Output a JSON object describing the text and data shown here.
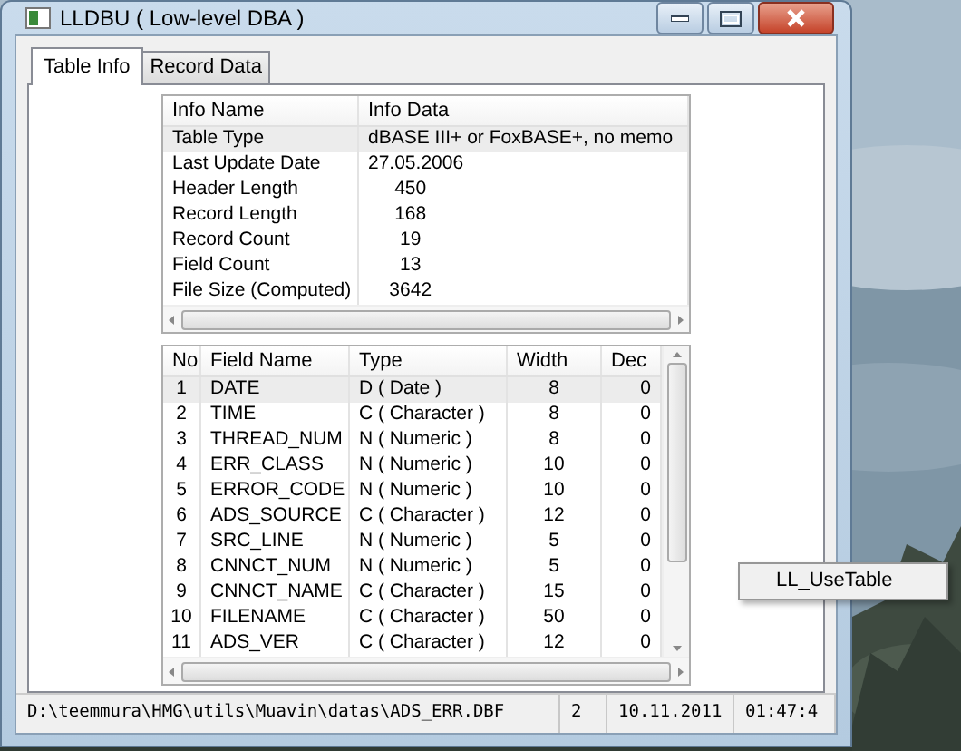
{
  "window": {
    "title": "LLDBU ( Low-level DBA )"
  },
  "tabs": [
    {
      "label": "Table Info",
      "selected": true
    },
    {
      "label": "Record Data",
      "selected": false
    }
  ],
  "info_table": {
    "columns": [
      "Info Name",
      "Info Data"
    ],
    "rows": [
      {
        "cells": [
          "Table Type",
          "dBASE III+ or FoxBASE+, no memo"
        ],
        "selected": true
      },
      {
        "cells": [
          "Last Update Date",
          "27.05.2006"
        ],
        "selected": false
      },
      {
        "cells": [
          "Header Length",
          "     450"
        ],
        "selected": false
      },
      {
        "cells": [
          "Record Length",
          "     168"
        ],
        "selected": false
      },
      {
        "cells": [
          "Record Count",
          "      19"
        ],
        "selected": false
      },
      {
        "cells": [
          "Field Count",
          "      13"
        ],
        "selected": false
      },
      {
        "cells": [
          "File Size (Computed)",
          "    3642"
        ],
        "selected": false
      }
    ]
  },
  "fields_table": {
    "columns": [
      "No",
      "Field Name",
      "Type",
      "Width",
      "Dec"
    ],
    "rows": [
      {
        "cells": [
          "1",
          "DATE",
          "D ( Date )",
          "8",
          "0"
        ],
        "selected": true
      },
      {
        "cells": [
          "2",
          "TIME",
          "C ( Character )",
          "8",
          "0"
        ],
        "selected": false
      },
      {
        "cells": [
          "3",
          "THREAD_NUM",
          "N ( Numeric )",
          "8",
          "0"
        ],
        "selected": false
      },
      {
        "cells": [
          "4",
          "ERR_CLASS",
          "N ( Numeric )",
          "10",
          "0"
        ],
        "selected": false
      },
      {
        "cells": [
          "5",
          "ERROR_CODE",
          "N ( Numeric )",
          "10",
          "0"
        ],
        "selected": false
      },
      {
        "cells": [
          "6",
          "ADS_SOURCE",
          "C ( Character )",
          "12",
          "0"
        ],
        "selected": false
      },
      {
        "cells": [
          "7",
          "SRC_LINE",
          "N ( Numeric )",
          "5",
          "0"
        ],
        "selected": false
      },
      {
        "cells": [
          "8",
          "CNNCT_NUM",
          "N ( Numeric )",
          "5",
          "0"
        ],
        "selected": false
      },
      {
        "cells": [
          "9",
          "CNNCT_NAME",
          "C ( Character )",
          "15",
          "0"
        ],
        "selected": false
      },
      {
        "cells": [
          "10",
          "FILENAME",
          "C ( Character )",
          "50",
          "0"
        ],
        "selected": false
      },
      {
        "cells": [
          "11",
          "ADS_VER",
          "C ( Character )",
          "12",
          "0"
        ],
        "selected": false
      }
    ]
  },
  "status_bar": [
    "D:\\teemmura\\HMG\\utils\\Muavin\\datas\\ADS_ERR.DBF",
    "2",
    "10.11.2011",
    "01:47:4"
  ],
  "popup_menu": {
    "items": [
      "LL_UseTable"
    ]
  }
}
